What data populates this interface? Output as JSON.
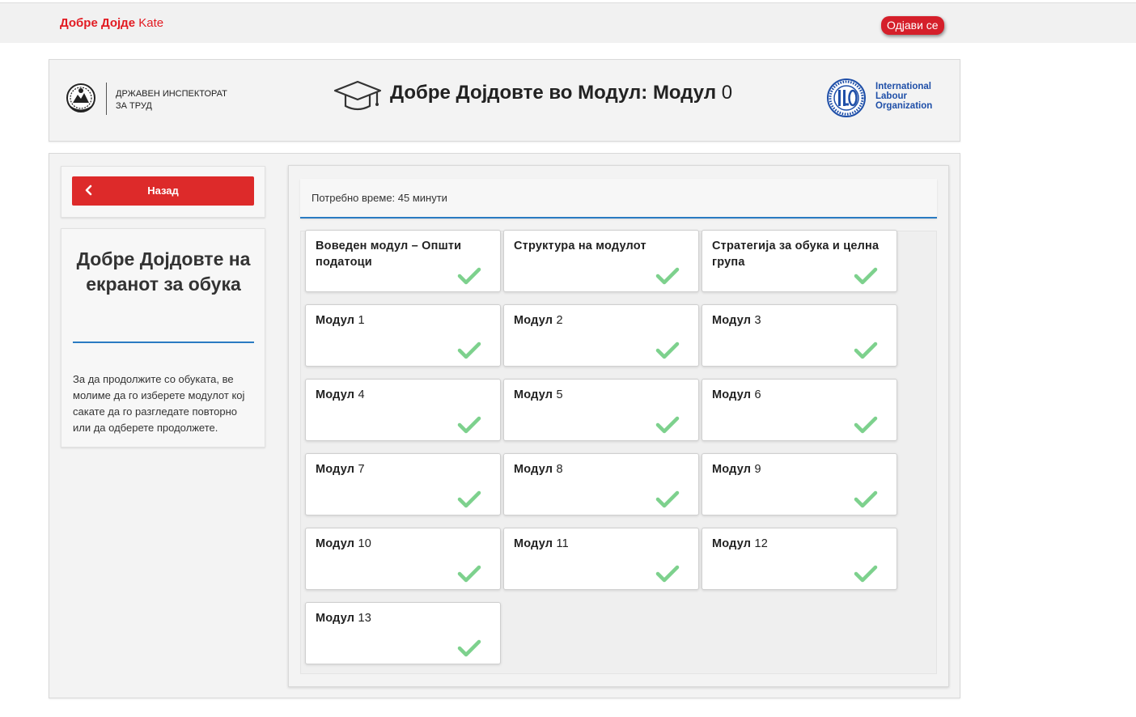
{
  "topbar": {
    "welcome": "Добре Дојде",
    "username": "Kate",
    "logout_label": "Одјави се"
  },
  "header": {
    "org_line1": "ДРЖАВЕН ИНСПЕКТОРАТ",
    "org_line2": "ЗА ТРУД",
    "title_prefix": "Добре Дојдовте во Модул: Модул",
    "title_number": "0",
    "partner_line1": "International",
    "partner_line2": "Labour",
    "partner_line3": "Organization"
  },
  "sidebar": {
    "back_label": "Назад",
    "welcome_title": "Добре Дојдовте на екранот за обука",
    "instructions": "За да продолжите со обуката, ве молиме да го изберете модулот кој сакате да го разгледате повторно или да одберете продолжете."
  },
  "main": {
    "time_label": "Потребно време: 45 минути",
    "check_color": "#7dd18d",
    "modules": [
      {
        "label": "Воведен модул – Општи податоци",
        "num": "",
        "completed": true
      },
      {
        "label": "Структура на модулот",
        "num": "",
        "completed": true
      },
      {
        "label": "Стратегија за обука и целна група",
        "num": "",
        "completed": true
      },
      {
        "label": "Модул",
        "num": "1",
        "completed": true
      },
      {
        "label": "Модул",
        "num": "2",
        "completed": true
      },
      {
        "label": "Модул",
        "num": "3",
        "completed": true
      },
      {
        "label": "Модул",
        "num": "4",
        "completed": true
      },
      {
        "label": "Модул",
        "num": "5",
        "completed": true
      },
      {
        "label": "Модул",
        "num": "6",
        "completed": true
      },
      {
        "label": "Модул",
        "num": "7",
        "completed": true
      },
      {
        "label": "Модул",
        "num": "8",
        "completed": true
      },
      {
        "label": "Модул",
        "num": "9",
        "completed": true
      },
      {
        "label": "Модул",
        "num": "10",
        "completed": true
      },
      {
        "label": "Модул",
        "num": "11",
        "completed": true
      },
      {
        "label": "Модул",
        "num": "12",
        "completed": true
      },
      {
        "label": "Модул",
        "num": "13",
        "completed": true
      }
    ]
  }
}
